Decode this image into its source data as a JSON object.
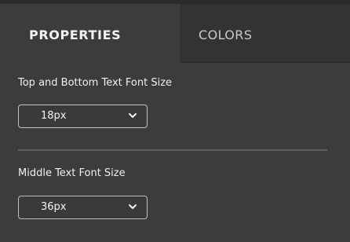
{
  "tabs": {
    "properties": "PROPERTIES",
    "colors": "COLORS",
    "active": "PROPERTIES"
  },
  "settings": {
    "top_bottom": {
      "label": "Top and Bottom Text Font Size",
      "value": "18px"
    },
    "middle": {
      "label": "Middle Text Font Size",
      "value": "36px"
    }
  },
  "colors": {
    "panel_bg": "#3c3c3c",
    "inactive_tab_bg": "#333333",
    "text": "#f2f2f2",
    "select_border": "#c0c0c0"
  }
}
